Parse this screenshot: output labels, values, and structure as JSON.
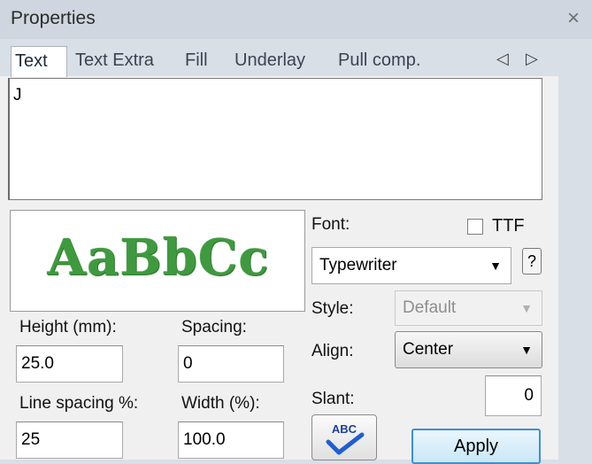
{
  "window": {
    "title": "Properties",
    "close_label": "×"
  },
  "tabs": [
    {
      "label": "Text",
      "active": true
    },
    {
      "label": "Text Extra",
      "active": false
    },
    {
      "label": "Fill",
      "active": false
    },
    {
      "label": "Underlay",
      "active": false
    },
    {
      "label": "Pull comp.",
      "active": false
    }
  ],
  "tab_nav": {
    "prev": "◁",
    "next": "▷"
  },
  "text_input": {
    "value": "J"
  },
  "preview": {
    "sample_text": "AaBbCc",
    "color": "#3f9a3f"
  },
  "fields": {
    "height": {
      "label": "Height (mm):",
      "value": "25.0"
    },
    "spacing": {
      "label": "Spacing:",
      "value": "0"
    },
    "line_spacing": {
      "label": "Line spacing %:",
      "value": "25"
    },
    "width": {
      "label": "Width (%):",
      "value": "100.0"
    }
  },
  "font": {
    "label": "Font:",
    "ttf_label": "TTF",
    "ttf_checked": false,
    "selected": "Typewriter",
    "help_label": "?"
  },
  "style": {
    "label": "Style:",
    "selected": "Default",
    "disabled": true
  },
  "align": {
    "label": "Align:",
    "selected": "Center"
  },
  "slant": {
    "label": "Slant:",
    "value": "0"
  },
  "buttons": {
    "spell_label": "ABC",
    "apply_label": "Apply"
  },
  "colors": {
    "accent": "#3c8fd6",
    "titlebar": "#cfd6df",
    "panel": "#f0f0f0"
  }
}
